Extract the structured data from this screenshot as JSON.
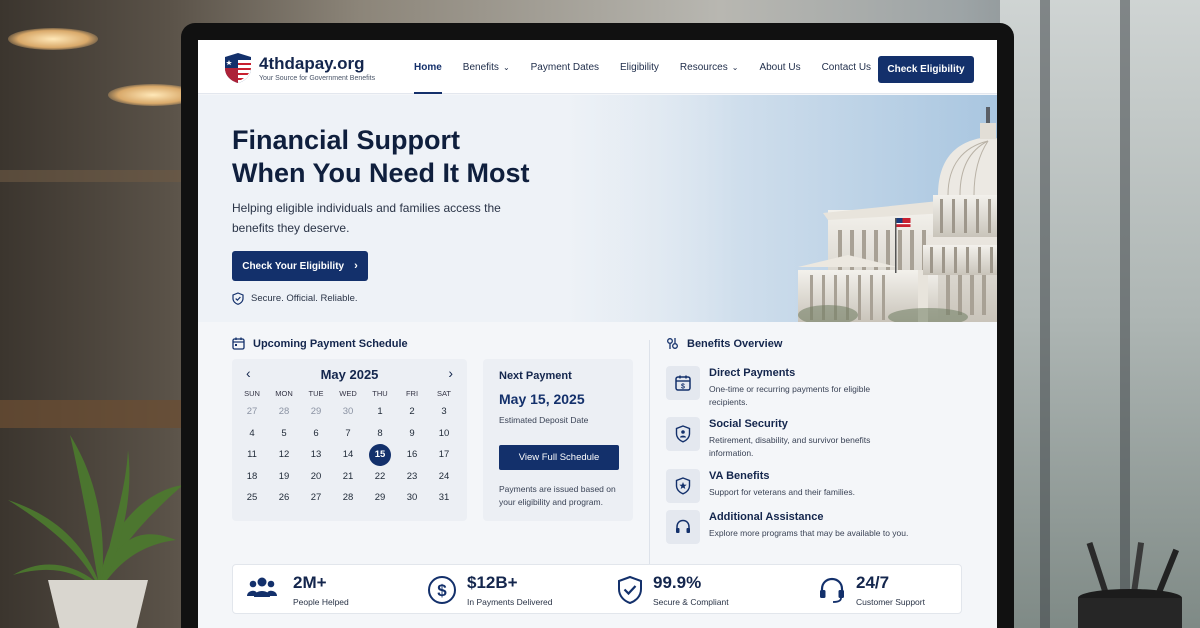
{
  "site": {
    "name": "4thdapay.org",
    "tagline": "Your Source for Government Benefits"
  },
  "nav": {
    "links": [
      {
        "label": "Home",
        "active": true
      },
      {
        "label": "Benefits",
        "dropdown": true
      },
      {
        "label": "Payment Dates"
      },
      {
        "label": "Eligibility"
      },
      {
        "label": "Resources",
        "dropdown": true
      },
      {
        "label": "About Us"
      },
      {
        "label": "Contact Us"
      }
    ],
    "cta": "Check Eligibility"
  },
  "hero": {
    "title_line1": "Financial Support",
    "title_line2": "When You Need It Most",
    "subtitle": "Helping eligible individuals and families access the benefits they deserve.",
    "button": "Check Your Eligibility",
    "trust": "Secure. Official. Reliable."
  },
  "schedule": {
    "heading": "Upcoming Payment Schedule",
    "month": "May 2025",
    "weekdays": [
      "SUN",
      "MON",
      "TUE",
      "WED",
      "THU",
      "FRI",
      "SAT"
    ],
    "weeks": [
      [
        "27",
        "28",
        "29",
        "30",
        "1",
        "2",
        "3"
      ],
      [
        "4",
        "5",
        "6",
        "7",
        "8",
        "9",
        "10"
      ],
      [
        "11",
        "12",
        "13",
        "14",
        "15",
        "16",
        "17"
      ],
      [
        "18",
        "19",
        "20",
        "21",
        "22",
        "23",
        "24"
      ],
      [
        "25",
        "26",
        "27",
        "28",
        "29",
        "30",
        "31"
      ]
    ],
    "selected_day": "15",
    "next_payment": {
      "label": "Next Payment",
      "date": "May 15, 2025",
      "note": "Estimated Deposit Date",
      "button": "View Full Schedule",
      "footnote": "Payments are issued based on your eligibility and program."
    }
  },
  "benefits": {
    "heading": "Benefits Overview",
    "items": [
      {
        "title": "Direct Payments",
        "desc": "One-time or recurring payments for eligible recipients.",
        "icon": "calendar-dollar-icon"
      },
      {
        "title": "Social Security",
        "desc": "Retirement, disability, and survivor benefits information.",
        "icon": "people-shield-icon"
      },
      {
        "title": "VA Benefits",
        "desc": "Support for veterans and their families.",
        "icon": "shield-star-icon"
      },
      {
        "title": "Additional Assistance",
        "desc": "Explore more programs that may be available to you.",
        "icon": "headset-icon"
      }
    ]
  },
  "stats": [
    {
      "value": "2M+",
      "label": "People Helped",
      "icon": "people-icon"
    },
    {
      "value": "$12B+",
      "label": "In Payments Delivered",
      "icon": "dollar-circle-icon"
    },
    {
      "value": "99.9%",
      "label": "Secure & Compliant",
      "icon": "shield-check-icon"
    },
    {
      "value": "24/7",
      "label": "Customer Support",
      "icon": "headset-icon"
    }
  ],
  "colors": {
    "primary": "#13306b",
    "heading": "#14264d",
    "background": "#f4f6f9"
  }
}
